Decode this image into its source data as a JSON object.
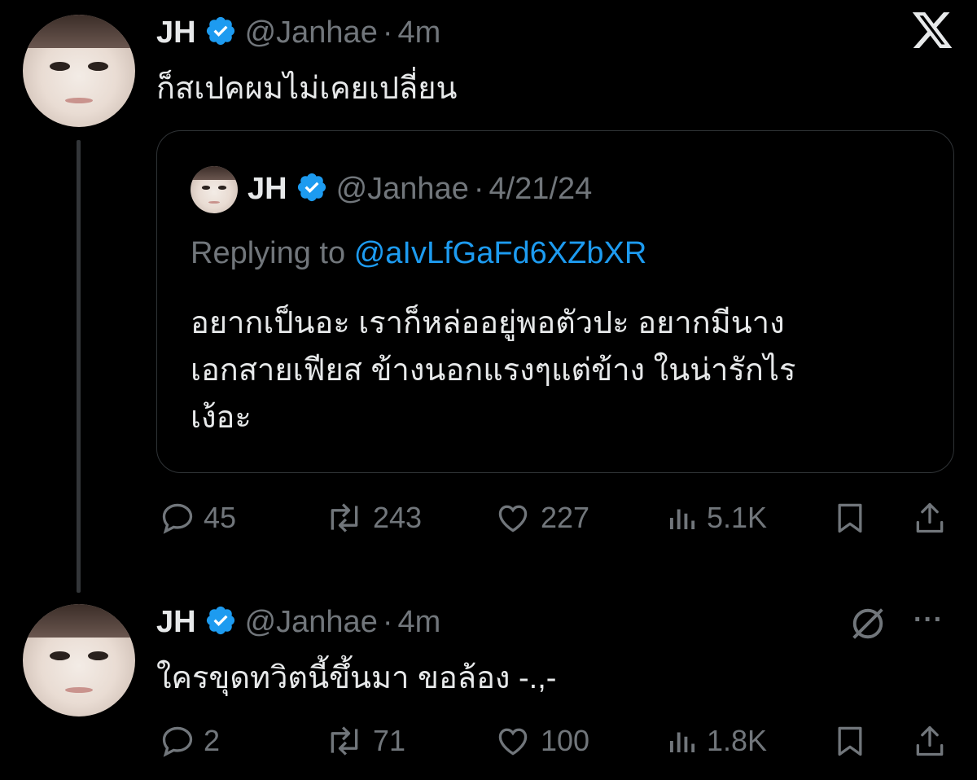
{
  "tweets": [
    {
      "name": "JH",
      "handle": "@Janhae",
      "sep": "·",
      "time": "4m",
      "text": "ก็สเปคผมไม่เคยเปลี่ยน",
      "quote": {
        "name": "JH",
        "handle": "@Janhae",
        "sep": "·",
        "time": "4/21/24",
        "replying_prefix": "Replying to",
        "replying_to": "@aIvLfGaFd6XZbXR",
        "text_lines": [
          "อยากเป็นอะ เราก็หล่ออยู่พอตัวปะ อยากมีนาง",
          "เอกสายเฟียส ข้างนอกแรงๆแต่ข้าง ในน่ารักไร",
          "เง้อะ"
        ]
      },
      "actions": {
        "replies": "45",
        "reposts": "243",
        "likes": "227",
        "views": "5.1K"
      }
    },
    {
      "name": "JH",
      "handle": "@Janhae",
      "sep": "·",
      "time": "4m",
      "text": "ใครขุดทวิตนี้ขึ้นมา ขอล้อง -.,-",
      "more": "···",
      "actions": {
        "replies": "2",
        "reposts": "71",
        "likes": "100",
        "views": "1.8K"
      }
    }
  ],
  "icons": {
    "close": "x-logo-icon",
    "verified": "verified-badge-icon",
    "grok": "grok-icon",
    "reply": "reply-icon",
    "repost": "repost-icon",
    "like": "heart-icon",
    "views": "views-icon",
    "bookmark": "bookmark-icon",
    "share": "share-icon"
  },
  "colors": {
    "background": "#000000",
    "text": "#e7e9ea",
    "muted": "#71767b",
    "link": "#1d9bf0",
    "verified": "#1d9bf0",
    "border": "#2f3336"
  }
}
